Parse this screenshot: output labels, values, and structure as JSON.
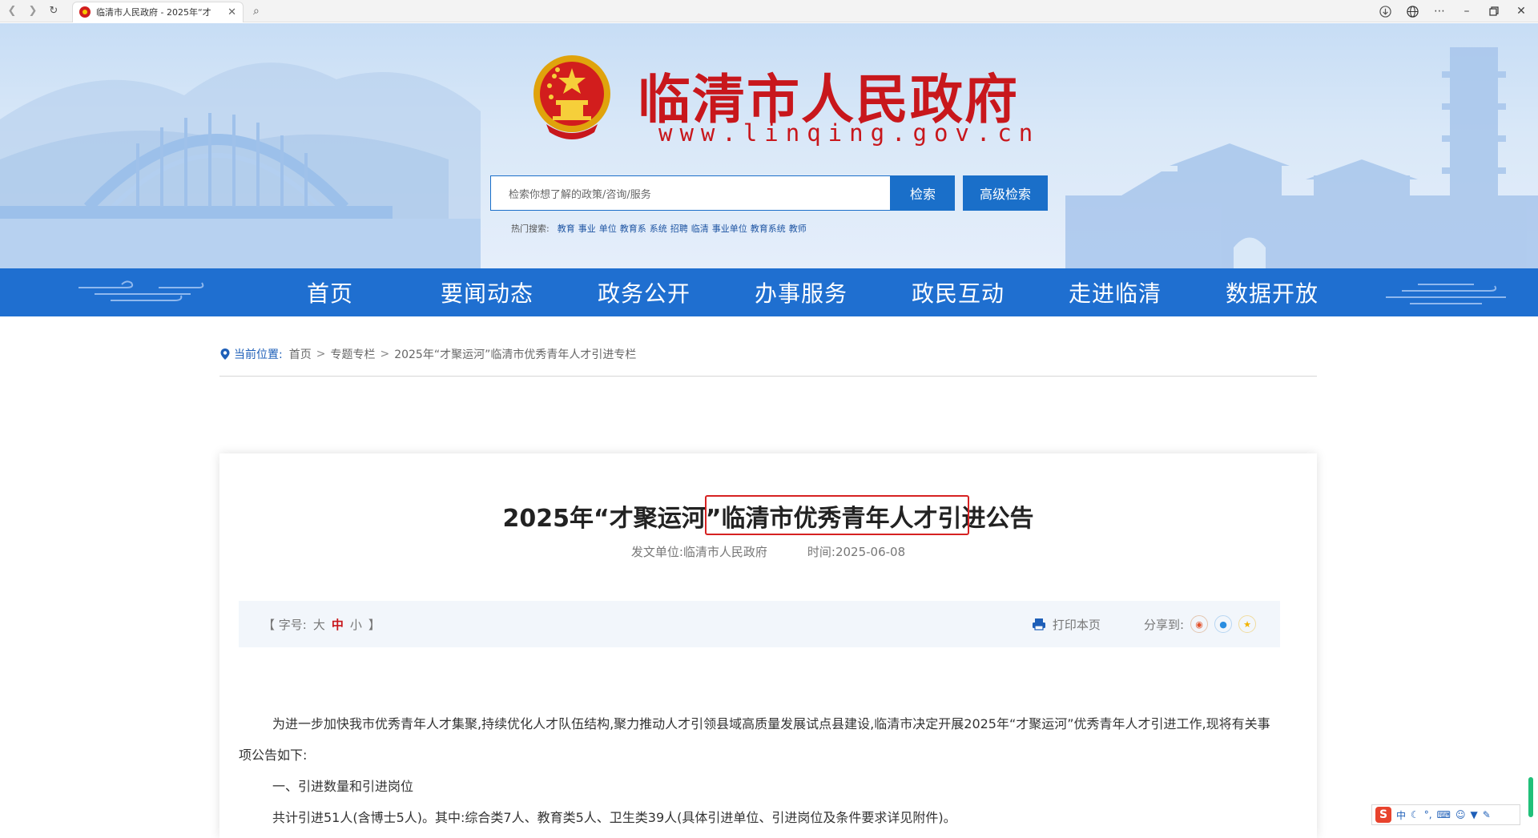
{
  "browser": {
    "tab_title": "临清市人民政府 - 2025年“才",
    "tab_close": "✕",
    "icons": [
      "back-icon",
      "forward-icon",
      "reload-icon",
      "search-icon",
      "download-icon",
      "globe-icon",
      "more-icon",
      "minimize-icon",
      "restore-icon",
      "close-icon"
    ]
  },
  "header": {
    "site_title": "临清市人民政府",
    "site_url": "www.linqing.gov.cn",
    "search_placeholder": "检索你想了解的政策/咨询/服务",
    "search_button": "检索",
    "advanced_search_button": "高级检索",
    "hot_label": "热门搜索:",
    "hot_items": [
      "教育",
      "事业",
      "单位",
      "教育系",
      "系统",
      "招聘",
      "临清",
      "事业单位",
      "教育系统",
      "教师"
    ]
  },
  "nav": {
    "items": [
      "首页",
      "要闻动态",
      "政务公开",
      "办事服务",
      "政民互动",
      "走进临清",
      "数据开放"
    ]
  },
  "breadcrumb": {
    "current_label": "当前位置:",
    "items": [
      "首页",
      "专题专栏",
      "2025年“才聚运河”临清市优秀青年人才引进专栏"
    ],
    "sep": ">"
  },
  "article": {
    "title": "2025年“才聚运河”临清市优秀青年人才引进公告",
    "publisher": "发文单位:临清市人民政府",
    "date": "时间:2025-06-08",
    "font_label": "【 字号:",
    "font_large": "大",
    "font_medium": "中",
    "font_small": "小",
    "font_close": "】",
    "print": "打印本页",
    "share_label": "分享到:",
    "paragraphs": [
      "为进一步加快我市优秀青年人才集聚,持续优化人才队伍结构,聚力推动人才引领县域高质量发展试点县建设,临清市决定开展2025年“才聚运河”优秀青年人才引进工作,现将有关事项公告如下:",
      "一、引进数量和引进岗位",
      "共计引进51人(含博士5人)。其中:综合类7人、教育类5人、卫生类39人(具体引进单位、引进岗位及条件要求详见附件)。"
    ]
  },
  "ime": {
    "logo": "S",
    "mode": "中"
  },
  "colors": {
    "nav_blue": "#1f6fd0",
    "title_red": "#c8171c",
    "highlight_red": "#d62222"
  }
}
